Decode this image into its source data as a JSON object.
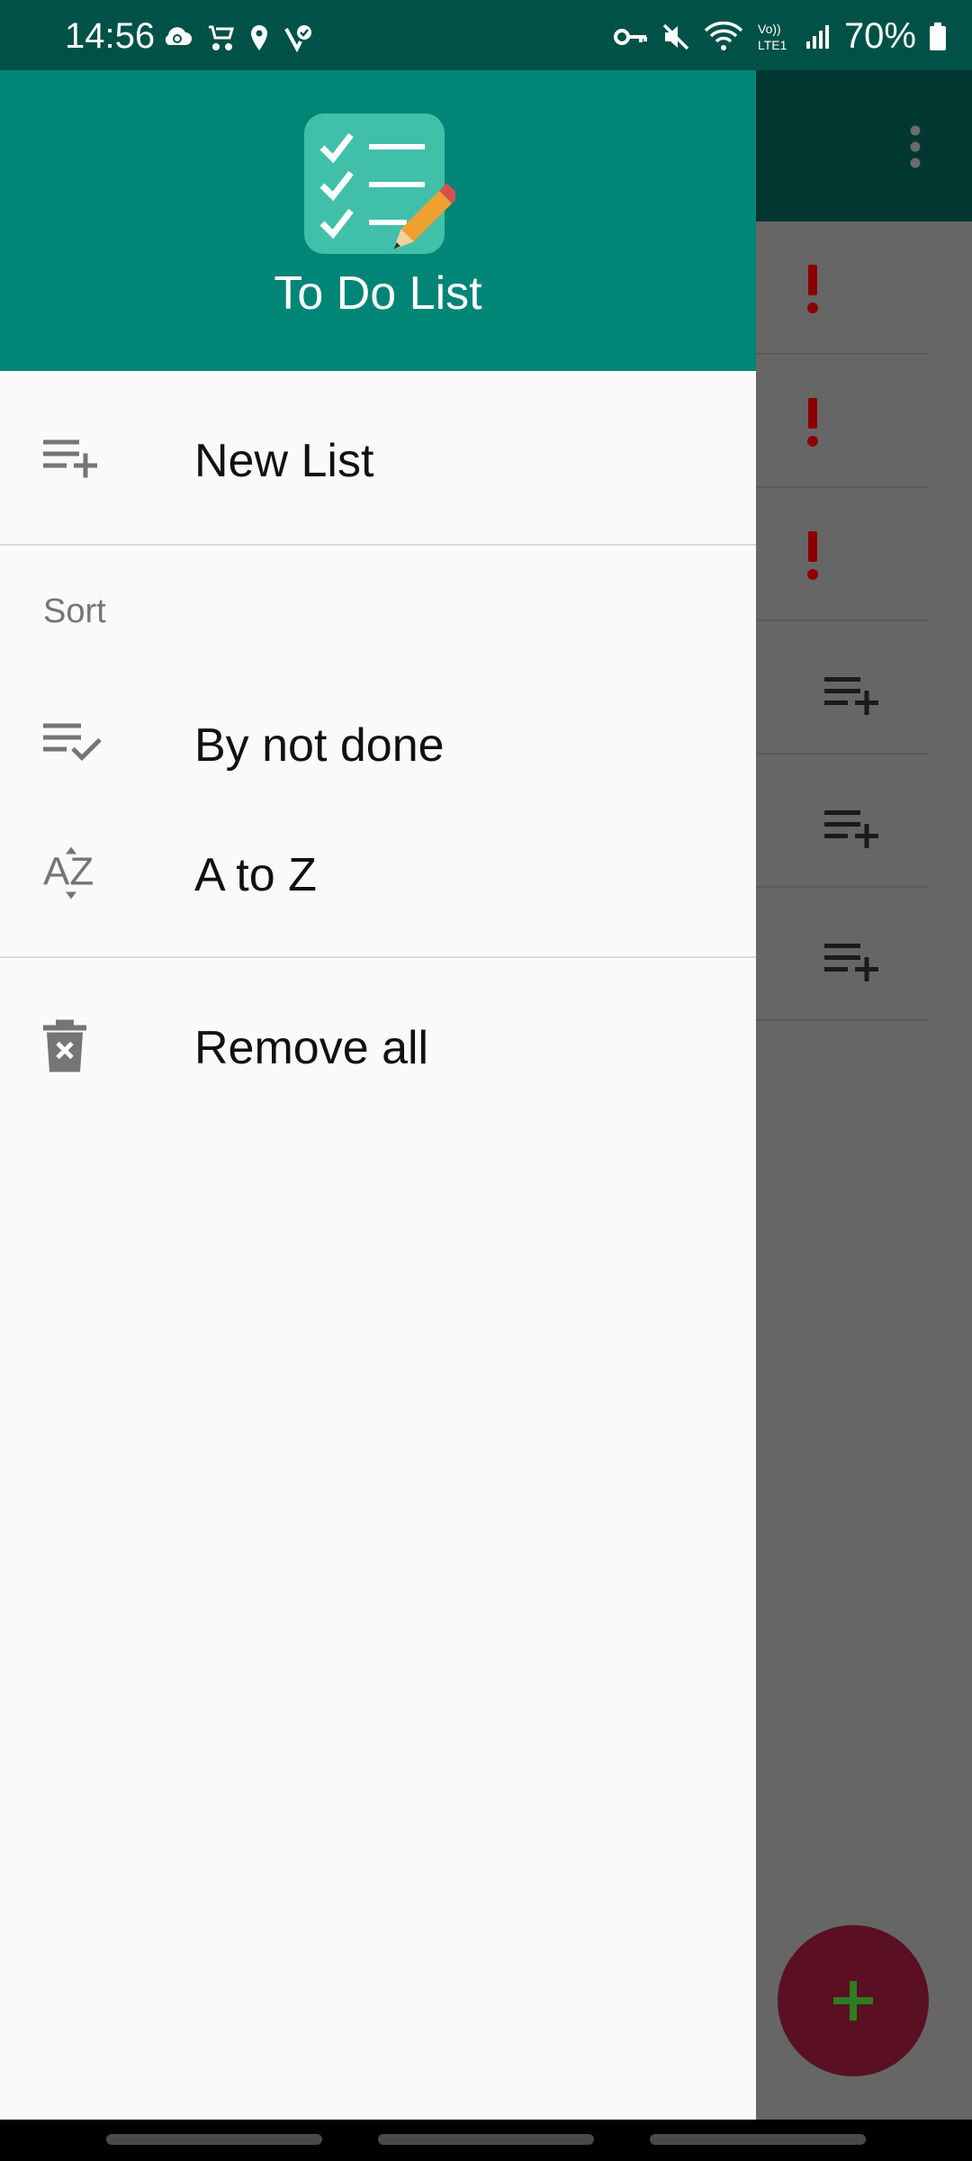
{
  "status_bar": {
    "time": "14:56",
    "battery": "70%",
    "left_icons": [
      "cloud-sync-icon",
      "stroller-icon",
      "location-icon",
      "verified-icon"
    ],
    "right_icons": [
      "vpn-key-icon",
      "mute-icon",
      "wifi-icon",
      "volte-icon",
      "signal-icon",
      "battery-icon"
    ],
    "volte_text": "Vo)) LTE1"
  },
  "drawer": {
    "app_title": "To Do List",
    "items": {
      "new_list": {
        "label": "New List",
        "icon": "playlist-add-icon"
      },
      "sort_header": "Sort",
      "by_not_done": {
        "label": "By not done",
        "icon": "playlist-check-icon"
      },
      "a_to_z": {
        "label": "A to Z",
        "icon": "sort-az-icon",
        "glyph": "AZ"
      },
      "remove_all": {
        "label": "Remove all",
        "icon": "delete-icon"
      }
    }
  },
  "background": {
    "rows": [
      {
        "icon": "priority-exclamation-icon",
        "glyph": "!"
      },
      {
        "icon": "priority-exclamation-icon",
        "glyph": "!"
      },
      {
        "icon": "priority-exclamation-icon",
        "glyph": "!"
      },
      {
        "icon": "playlist-add-icon"
      },
      {
        "icon": "playlist-add-icon"
      },
      {
        "icon": "playlist-add-icon"
      }
    ],
    "fab_icon": "add-icon"
  },
  "colors": {
    "header": "#008577",
    "status_bar": "#005147",
    "drawer_bg": "#fafafa",
    "priority": "#8b0000",
    "fab": "#5a0f22",
    "fab_plus": "#2e7d1f"
  }
}
